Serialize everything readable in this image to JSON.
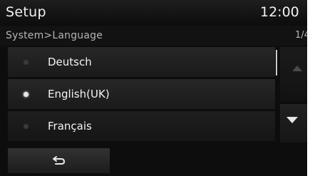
{
  "header": {
    "title": "Setup",
    "clock": "12:00"
  },
  "breadcrumb": {
    "path": "System>Language",
    "page_indicator": "1/4"
  },
  "languages": [
    {
      "label": "Deutsch",
      "selected": false
    },
    {
      "label": "English(UK)",
      "selected": true
    },
    {
      "label": "Français",
      "selected": false
    }
  ],
  "icons": {
    "back": "back-arrow-icon",
    "scroll_up": "arrow-up-icon",
    "scroll_down": "arrow-down-icon",
    "radio_selected": "radio-on-icon",
    "radio_unselected": "radio-off-icon"
  },
  "colors": {
    "background": "#0d0d0d",
    "item": "#222222",
    "text": "#f4f4f4",
    "subtext": "#b4b4b4",
    "arrow_active": "#e6e6e6",
    "arrow_disabled": "#4a4a4a"
  }
}
